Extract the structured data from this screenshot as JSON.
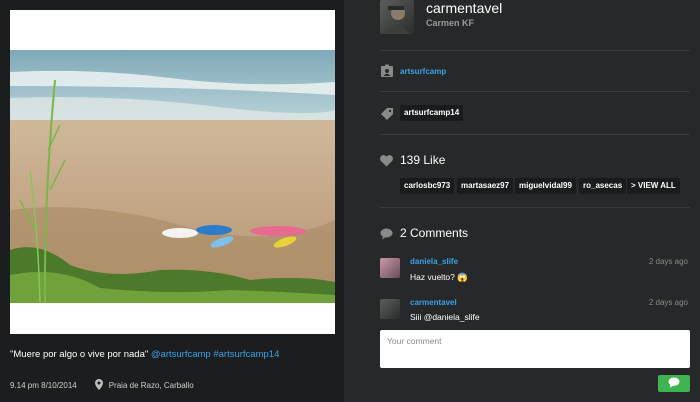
{
  "post": {
    "caption_quote": "\"Muere por algo o vive por nada\"",
    "caption_mention": "@artsurfcamp",
    "caption_hashtag": "#artsurfcamp14",
    "timestamp": "9.14 pm 8/10/2014",
    "location": "Praia de Razo, Carballo"
  },
  "author": {
    "username": "carmentavel",
    "real_name": "Carmen KF"
  },
  "tagged_user": "artsurfcamp",
  "hashtags": [
    "artsurfcamp14"
  ],
  "likes": {
    "title": "139 Like",
    "users": [
      "carlosbc973",
      "martasaez97",
      "miguelvidal99",
      "ro_asecas"
    ],
    "view_all": "> VIEW ALL"
  },
  "comments": {
    "title": "2 Comments",
    "items": [
      {
        "user": "daniela_slife",
        "time": "2 days ago",
        "text": "Haz vuelto? 😱"
      },
      {
        "user": "carmentavel",
        "time": "2 days ago",
        "text": "Siii @daniela_slife"
      }
    ],
    "placeholder": "Your comment"
  },
  "icons": {
    "user_badge": "user-badge-icon",
    "tag": "tag-icon",
    "heart": "heart-icon",
    "comment": "speech-bubble-icon",
    "pin": "map-pin-icon",
    "send": "speech-bubble-icon"
  },
  "colors": {
    "link": "#39a4e6",
    "send_button": "#3fb34f",
    "right_panel": "#272829",
    "left_panel": "#1c1d1e"
  }
}
